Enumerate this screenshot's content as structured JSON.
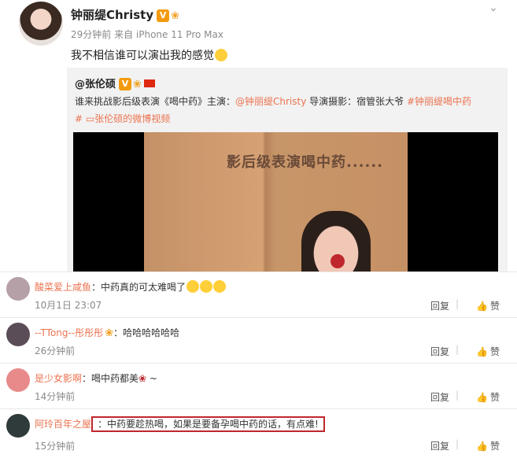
{
  "post": {
    "author": "钟丽缇Christy",
    "v_badge": "V",
    "meta": "29分钟前 来自 iPhone 11 Pro Max",
    "text": "我不相信谁可以演出我的感觉",
    "repost": {
      "author": "@张伦硕",
      "v_badge": "V",
      "line1_prefix": "谁来挑战影后级表演《喝中药》主演：",
      "line1_mention": "@钟丽缇Christy",
      "line1_mid": " 导演摄影：宿管张大爷 ",
      "line1_tag": "#钟丽缇喝中药",
      "line2": "#  ▭张伦硕的微博视频",
      "video_caption": "影后级表演喝中药......"
    }
  },
  "comments": [
    {
      "name": "酸菜爱上咸鱼",
      "text": "：中药真的可太难喝了",
      "time": "10月1日 23:07",
      "reply": "回复",
      "like": "赞",
      "avatar_color": "#b6a0a8"
    },
    {
      "name": "--TTong--彤彤彤",
      "text": "：哈哈哈哈哈哈",
      "time": "26分钟前",
      "reply": "回复",
      "like": "赞",
      "avatar_color": "#5a4d58"
    },
    {
      "name": "是少女影啊",
      "text": "：喝中药都美",
      "text_suffix": " ~",
      "time": "14分钟前",
      "reply": "回复",
      "like": "赞",
      "avatar_color": "#e98a8a"
    },
    {
      "name": "阿玲百年之屋",
      "text": "：中药要趁热喝，如果是要备孕喝中药的话，有点难!",
      "time": "15分钟前",
      "reply": "回复",
      "like": "赞",
      "avatar_color": "#2f3a3a"
    }
  ]
}
